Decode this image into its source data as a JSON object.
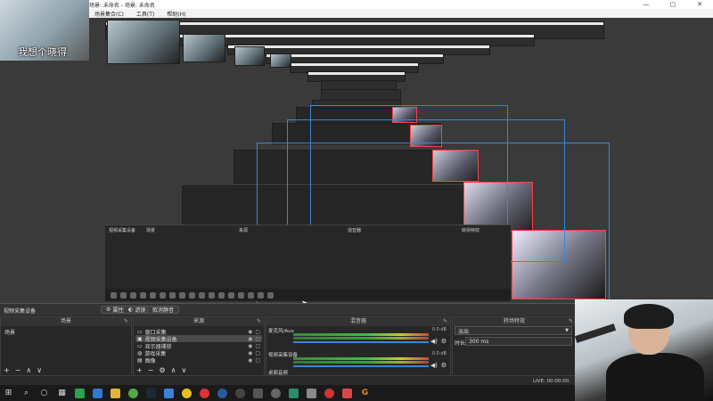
{
  "window": {
    "title": "场景: 未命名 - 场景: 未命名",
    "min_glyph": "—",
    "max_glyph": "▢",
    "close_glyph": "✕"
  },
  "menu": {
    "items": [
      "场景集合(C)",
      "工具(T)",
      "帮助(H)"
    ]
  },
  "overlay_subtitle": "我想个晓得",
  "dock": {
    "scene_label": "视频采集设备",
    "properties_label": "属性",
    "filters_label": "滤镜",
    "exit_scene_button": "取消静音"
  },
  "panels": {
    "scenes": {
      "title": "场景",
      "items": [
        "场景"
      ]
    },
    "sources": {
      "title": "来源",
      "items": [
        {
          "label": "窗口采集",
          "icon": "window-icon"
        },
        {
          "label": "视频采集设备",
          "icon": "camera-icon"
        },
        {
          "label": "显示器捕获",
          "icon": "monitor-icon"
        },
        {
          "label": "游戏采集",
          "icon": "gamepad-icon"
        },
        {
          "label": "图像",
          "icon": "image-icon"
        }
      ]
    },
    "mixer": {
      "title": "混音器",
      "tracks": [
        {
          "name": "麦克风/Aux",
          "db": "0.0 dB"
        },
        {
          "name": "视频采集设备",
          "db": "0.0 dB"
        },
        {
          "name": "桌面音频",
          "db": ""
        }
      ]
    },
    "transitions": {
      "title": "转场特效",
      "selected": "淡出",
      "duration_label": "时长",
      "duration_value": "300 ms"
    }
  },
  "status": {
    "live": "LIVE: 00:00:00"
  },
  "taskbar": {
    "start_glyph": "⊞",
    "search_glyph": "⌕",
    "items": [
      "start",
      "search",
      "cortana",
      "taskview",
      "wechat",
      "explorer",
      "folder",
      "360",
      "steam",
      "chrome",
      "obs",
      "netease",
      "edge",
      "camera",
      "record",
      "photos",
      "netease-music",
      "app-g"
    ]
  },
  "tools_glyphs": {
    "add": "+",
    "remove": "−",
    "up": "∧",
    "down": "∨",
    "gear": "⚙",
    "speaker": "🔊",
    "eye": "👁",
    "lock": "🔒"
  }
}
